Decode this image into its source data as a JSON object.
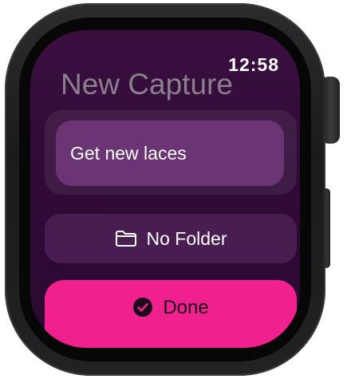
{
  "status": {
    "time": "12:58"
  },
  "screen": {
    "title": "New Capture"
  },
  "capture": {
    "text": "Get new laces"
  },
  "folder": {
    "label": "No Folder",
    "icon": "folder-icon"
  },
  "done": {
    "label": "Done",
    "icon": "checkmark-circle-icon"
  },
  "colors": {
    "background": "#2e0b34",
    "field": "#6b3575",
    "folder_button": "#4a1d52",
    "accent": "#f0208f"
  }
}
